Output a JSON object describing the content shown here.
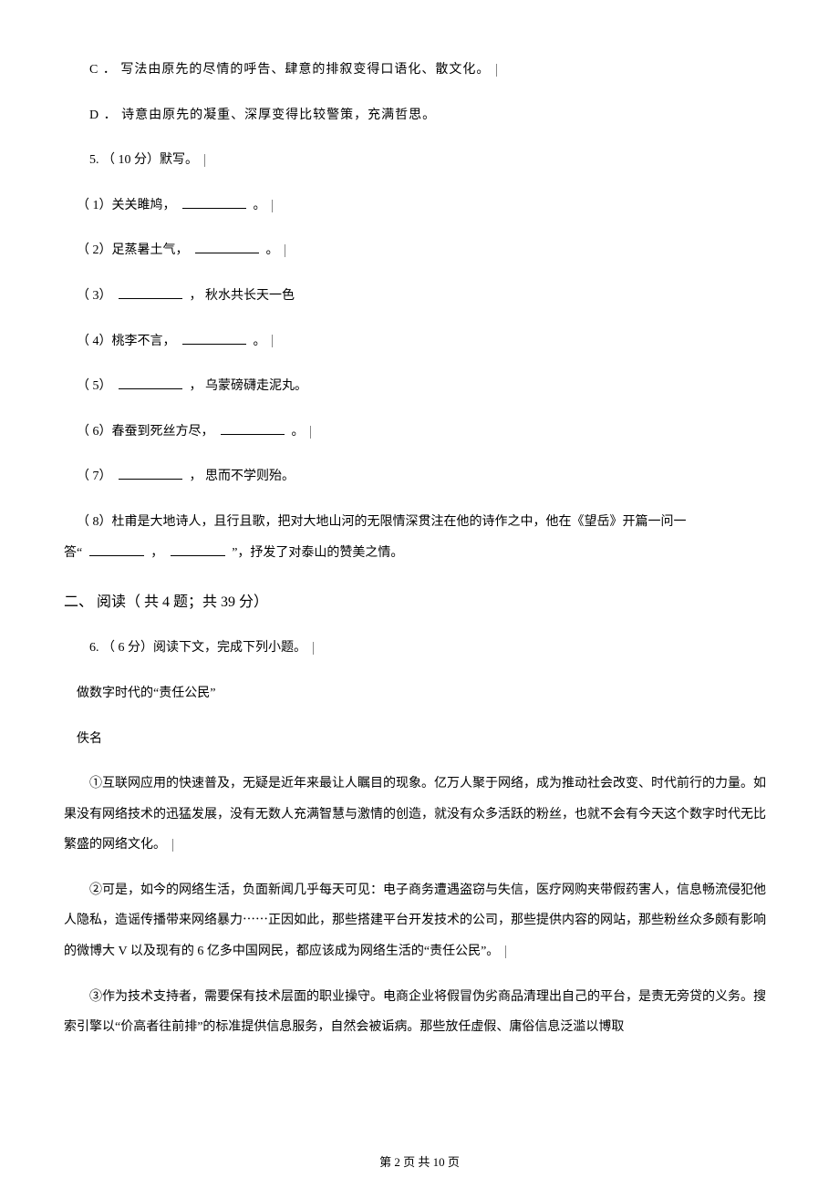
{
  "options": {
    "c": "C ．  写法由原先的尽情的呼告、肆意的排叙变得口语化、散文化。",
    "d": "D ．  诗意由原先的凝重、深厚变得比较警策，充满哲思。"
  },
  "q5": {
    "head": "5.   （ 10 分）默写。",
    "i1a": "（ 1）关关雎鸠，",
    "period1": "。",
    "i2a": "（ 2）足蒸暑土气，",
    "period2": "。",
    "i3a": "（ 3）",
    "i3b": "，   秋水共长天一色",
    "i4a": "（ 4）桃李不言，",
    "period4": "。",
    "i5a": "（ 5）",
    "i5b": "，   乌蒙磅礴走泥丸。",
    "i6a": "（ 6）春蚕到死丝方尽，",
    "period6": "。",
    "i7a": "（ 7）",
    "i7b": "，   思而不学则殆。",
    "i8a": "（ 8）杜甫是大地诗人，且行且歌，把对大地山河的无限情深贯注在他的诗作之中，他在《望岳》开篇一问一",
    "i8b": "答“",
    "i8c": "，",
    "i8d": "”，抒发了对泰山的赞美之情。"
  },
  "section2": {
    "heading": "二、  阅读（ 共 4 题；共  39 分）"
  },
  "q6": {
    "head": "6.   （ 6 分）阅读下文，完成下列小题。",
    "title": "做数字时代的“责任公民”",
    "author": "佚名",
    "p1": "①互联网应用的快速普及，无疑是近年来最让人瞩目的现象。亿万人聚于网络，成为推动社会改变、时代前行的力量。如果没有网络技术的迅猛发展，没有无数人充满智慧与激情的创造，就没有众多活跃的粉丝，也就不会有今天这个数字时代无比繁盛的网络文化。",
    "p2": "②可是，如今的网络生活，负面新闻几乎每天可见：电子商务遭遇盗窃与失信，医疗网购夹带假药害人，信息畅流侵犯他人隐私，造谣传播带来网络暴力⋯⋯正因如此，那些搭建平台开发技术的公司，那些提供内容的网站，那些粉丝众多颇有影响的微博大     V 以及现有的   6 亿多中国网民，都应该成为网络生活的“责任公民”。",
    "p3": "③作为技术支持者，需要保有技术层面的职业操守。电商企业将假冒伪劣商品清理出自己的平台，是责无旁贷的义务。搜索引擎以“价高者往前排”的标准提供信息服务，自然会被诟病。那些放任虚假、庸俗信息泛滥以博取"
  },
  "footer": {
    "text": "第  2  页  共  10  页"
  }
}
